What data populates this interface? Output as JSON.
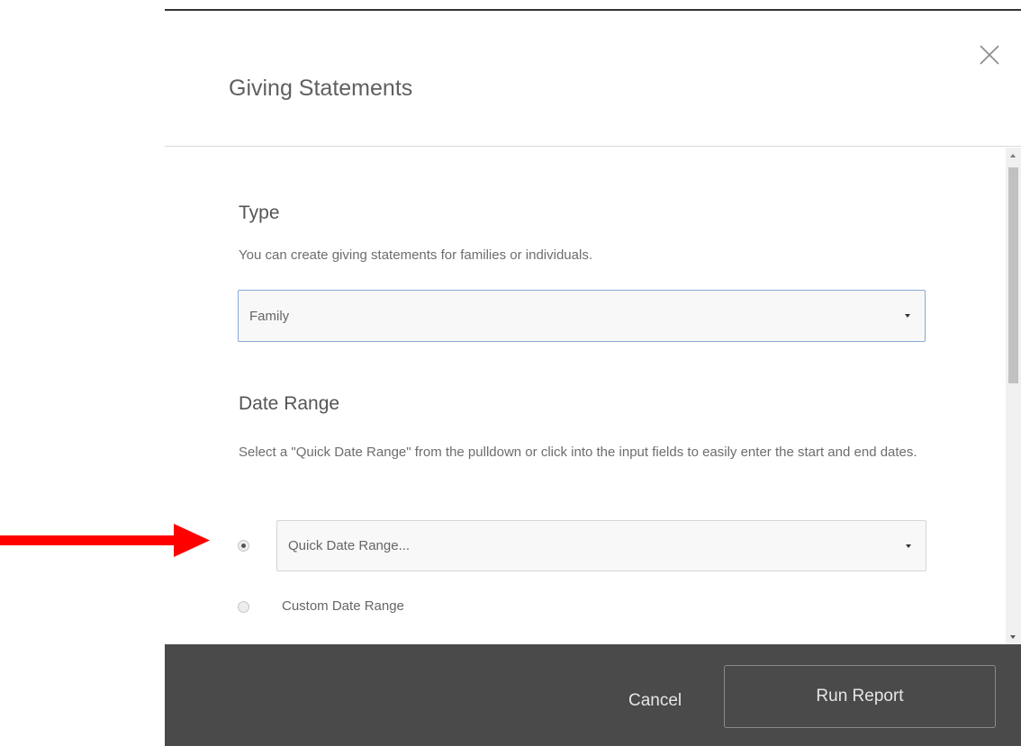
{
  "topbar": {
    "cutoff_text": ""
  },
  "modal": {
    "title": "Giving Statements",
    "close_icon": "close-icon"
  },
  "type_section": {
    "title": "Type",
    "description": "You can create giving statements for families or individuals.",
    "select_value": "Family"
  },
  "date_range_section": {
    "title": "Date Range",
    "description": "Select a \"Quick Date Range\" from the pulldown or click into the input fields to easily enter the start and end dates.",
    "quick_select_value": "Quick Date Range...",
    "options": [
      {
        "label": "Quick Date Range",
        "checked": true
      },
      {
        "label": "Custom Date Range",
        "checked": false
      }
    ]
  },
  "footer": {
    "cancel_label": "Cancel",
    "run_label": "Run Report"
  },
  "colors": {
    "footer_bg": "#4a4a4a",
    "arrow": "#ff0000",
    "focus_border": "#88a9d8"
  }
}
